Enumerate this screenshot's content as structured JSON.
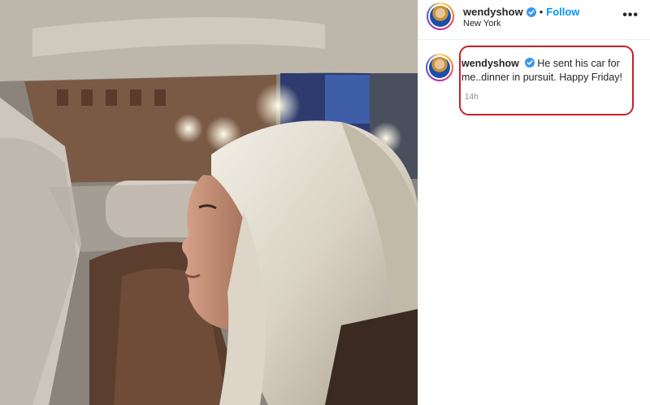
{
  "post": {
    "username": "wendyshow",
    "follow_label": "Follow",
    "separator": "•",
    "location": "New York",
    "more_label": "•••"
  },
  "caption": {
    "username": "wendyshow",
    "text": "He sent his car for me..dinner in pursuit. Happy Friday!",
    "time": "14h"
  },
  "colors": {
    "verified": "#3897f0",
    "follow": "#0095f6",
    "highlight_border": "#c8202a"
  },
  "icons": {
    "verified": "verified-badge-icon",
    "more": "more-options-icon"
  }
}
